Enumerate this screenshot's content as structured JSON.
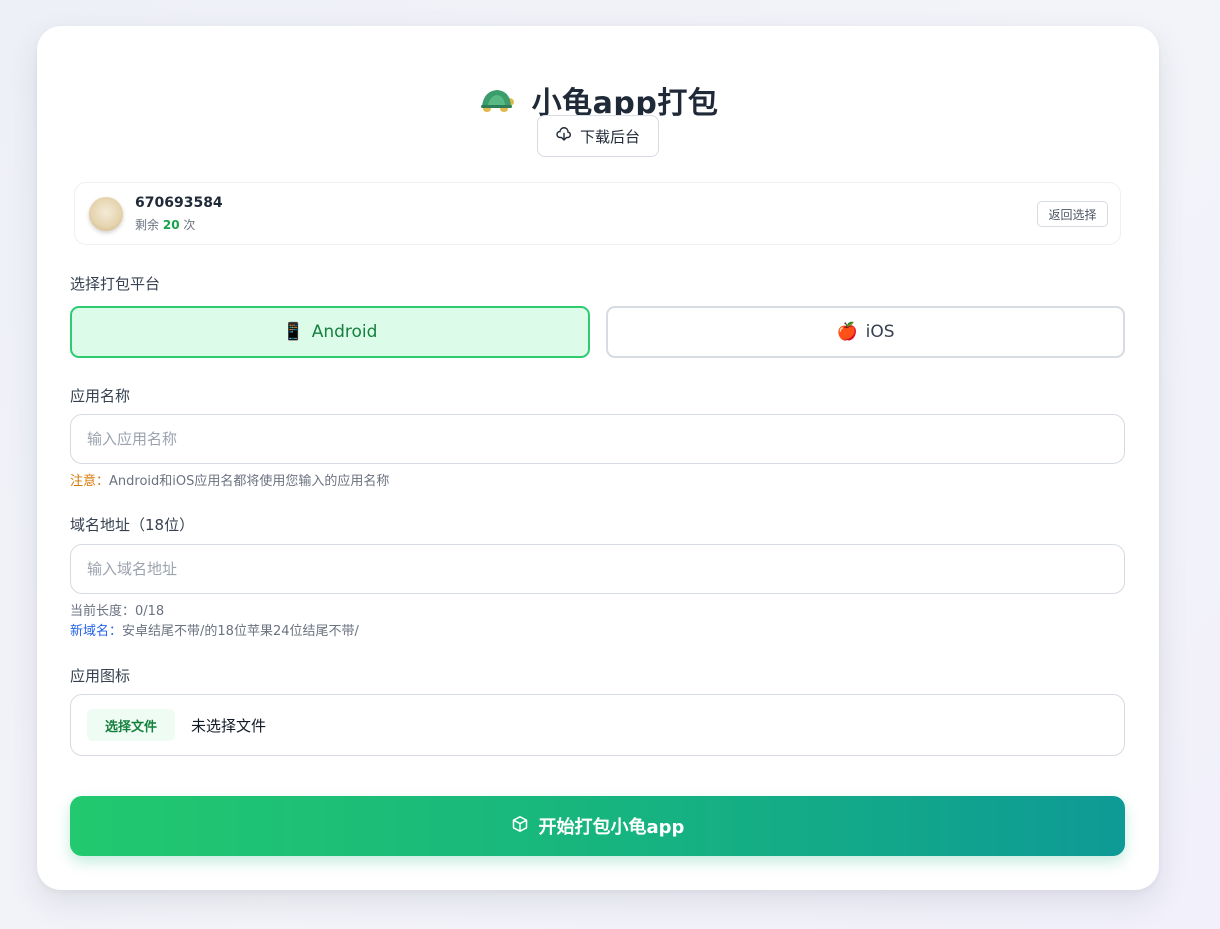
{
  "header": {
    "title": "小龟app打包",
    "download_label": "下载后台"
  },
  "user": {
    "id": "670693584",
    "remain_prefix": "剩余",
    "remain_count": "20",
    "remain_suffix": "次",
    "back_label": "返回选择"
  },
  "platform": {
    "label": "选择打包平台",
    "options": [
      {
        "icon": "📱",
        "label": "Android",
        "selected": true
      },
      {
        "icon": "🍎",
        "label": "iOS",
        "selected": false
      }
    ]
  },
  "app_name": {
    "label": "应用名称",
    "placeholder": "输入应用名称",
    "note_prefix": "注意：",
    "note_text": "Android和iOS应用名都将使用您输入的应用名称"
  },
  "domain": {
    "label": "域名地址（18位）",
    "placeholder": "输入域名地址",
    "length_text": "当前长度：0/18",
    "note_prefix": "新域名：",
    "note_text": "安卓结尾不带/的18位苹果24位结尾不带/"
  },
  "icon_upload": {
    "label": "应用图标",
    "button_label": "选择文件",
    "status": "未选择文件"
  },
  "submit": {
    "label": "开始打包小龟app"
  },
  "colors": {
    "accent": "#22c96e",
    "accent_end": "#0e9a96",
    "warn": "#d97706",
    "info": "#2563eb"
  }
}
